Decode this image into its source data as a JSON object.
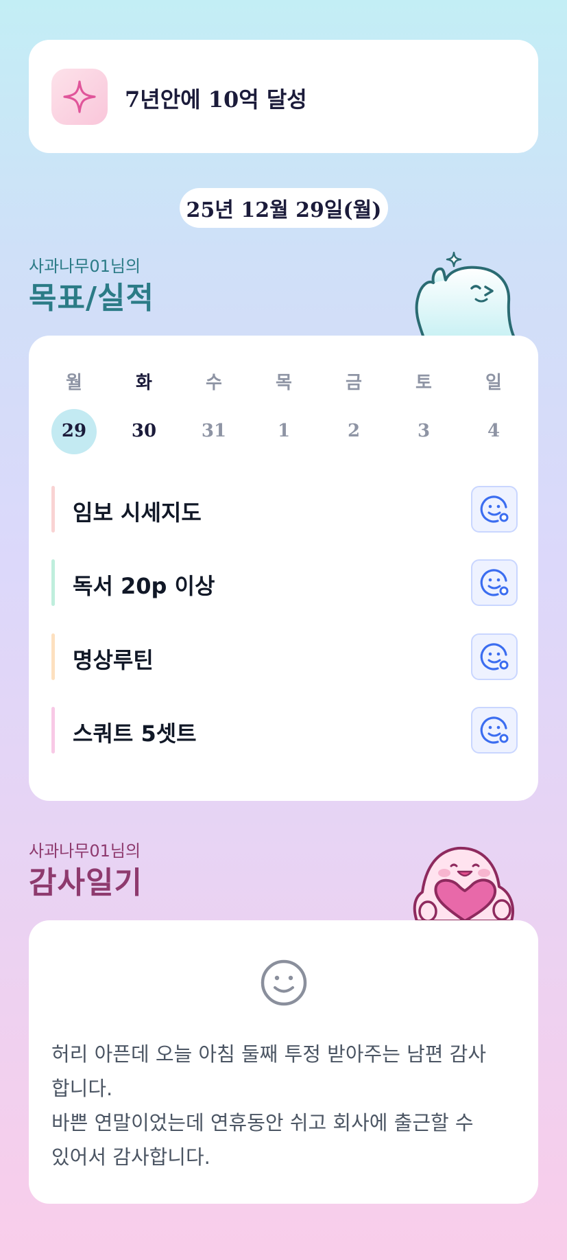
{
  "goal": {
    "text": "7년안에 10억 달성",
    "icon": "sparkle-icon"
  },
  "date_label": "25년 12월 29일(월)",
  "goals_section": {
    "subtitle": "사과나무01님의",
    "title": "목표/실적",
    "title_color": "#2b7b86"
  },
  "week": {
    "days": [
      "월",
      "화",
      "수",
      "목",
      "금",
      "토",
      "일"
    ],
    "dates": [
      "29",
      "30",
      "31",
      "1",
      "2",
      "3",
      "4"
    ],
    "selected_index": 0,
    "highlight_color": "#c3eaf2"
  },
  "tasks": [
    {
      "label": "임보 시세지도",
      "color": "#f9d3d3",
      "icon": "smile-add-icon"
    },
    {
      "label": "독서 20p 이상",
      "color": "#bfeedd",
      "icon": "smile-add-icon"
    },
    {
      "label": "명상루틴",
      "color": "#fde0bf",
      "icon": "smile-add-icon"
    },
    {
      "label": "스쿼트 5셋트",
      "color": "#f8c9e6",
      "icon": "smile-add-icon"
    }
  ],
  "gratitude_section": {
    "subtitle": "사과나무01님의",
    "title": "감사일기",
    "title_color": "#8e3a6e",
    "mood_icon": "smile-face-icon",
    "text": "허리 아픈데 오늘 아침 둘째 투정 받아주는 남편 감사\n합니다.\n바쁜 연말이었는데 연휴동안 쉬고 회사에 출근할 수\n있어서 감사합니다."
  }
}
